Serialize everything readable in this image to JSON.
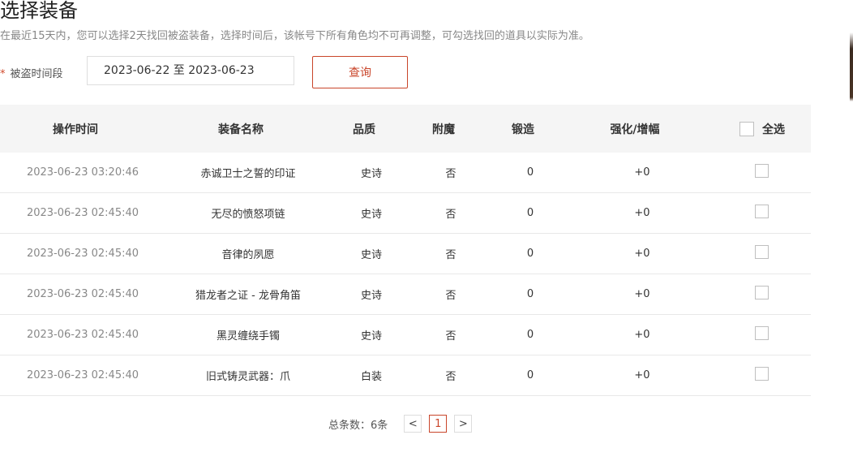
{
  "page": {
    "title": "选择装备",
    "notice": "在最近15天内，您可以选择2天找回被盗装备，选择时间后，该帐号下所有角色均不可再调整，可勾选找回的道具以实际为准。"
  },
  "filter": {
    "required_mark": "*",
    "label": "被盗时间段",
    "date_range": "2023-06-22 至 2023-06-23",
    "query_label": "查询"
  },
  "table": {
    "columns": [
      "操作时间",
      "装备名称",
      "品质",
      "附魔",
      "锻造",
      "强化/增幅"
    ],
    "select_all_label": "全选",
    "rows": [
      {
        "time": "2023-06-23 03:20:46",
        "name": "赤诚卫士之誓的印证",
        "quality": "史诗",
        "enchant": "否",
        "forge": "0",
        "enhance": "+0"
      },
      {
        "time": "2023-06-23 02:45:40",
        "name": "无尽的愤怒项链",
        "quality": "史诗",
        "enchant": "否",
        "forge": "0",
        "enhance": "+0"
      },
      {
        "time": "2023-06-23 02:45:40",
        "name": "音律的夙愿",
        "quality": "史诗",
        "enchant": "否",
        "forge": "0",
        "enhance": "+0"
      },
      {
        "time": "2023-06-23 02:45:40",
        "name": "猎龙者之证 - 龙骨角笛",
        "quality": "史诗",
        "enchant": "否",
        "forge": "0",
        "enhance": "+0"
      },
      {
        "time": "2023-06-23 02:45:40",
        "name": "黑灵缠绕手镯",
        "quality": "史诗",
        "enchant": "否",
        "forge": "0",
        "enhance": "+0"
      },
      {
        "time": "2023-06-23 02:45:40",
        "name": "旧式铸灵武器：爪",
        "quality": "白装",
        "enchant": "否",
        "forge": "0",
        "enhance": "+0"
      }
    ]
  },
  "pagination": {
    "total_text": "总条数：6条",
    "prev": "<",
    "current": "1",
    "next": ">"
  },
  "colors": {
    "accent": "#c9452a",
    "header_bg": "#f5f5f5"
  }
}
